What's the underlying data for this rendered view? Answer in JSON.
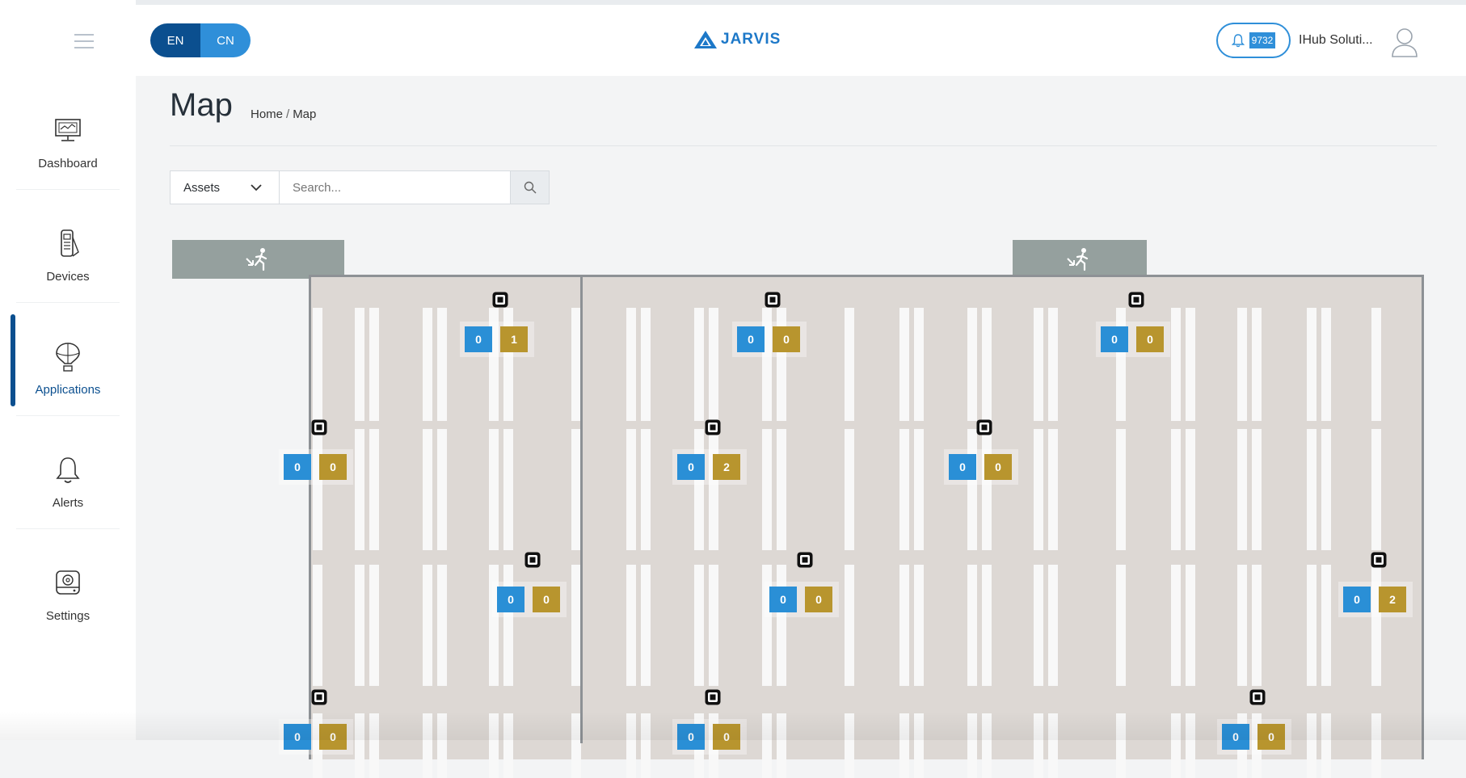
{
  "header": {
    "languages": [
      "EN",
      "CN"
    ],
    "active_language": "EN",
    "brand": "JARVIS",
    "notification_count": "9732",
    "user_name": "IHub Soluti..."
  },
  "sidebar": {
    "items": [
      {
        "label": "Dashboard",
        "icon": "monitor-icon"
      },
      {
        "label": "Devices",
        "icon": "devices-icon"
      },
      {
        "label": "Applications",
        "icon": "balloon-icon"
      },
      {
        "label": "Alerts",
        "icon": "bell-icon"
      },
      {
        "label": "Settings",
        "icon": "settings-icon"
      }
    ],
    "active": "Applications"
  },
  "page": {
    "title": "Map",
    "breadcrumb": [
      "Home",
      "Map"
    ]
  },
  "filter": {
    "category": "Assets",
    "search_placeholder": "Search..."
  },
  "map": {
    "entrances": 2,
    "sensors": [
      {
        "blue": "0",
        "gold": "1"
      },
      {
        "blue": "0",
        "gold": "0"
      },
      {
        "blue": "0",
        "gold": "0"
      },
      {
        "blue": "0",
        "gold": "0"
      },
      {
        "blue": "0",
        "gold": "2"
      },
      {
        "blue": "0",
        "gold": "0"
      },
      {
        "blue": "0",
        "gold": "0"
      },
      {
        "blue": "0",
        "gold": "0"
      },
      {
        "blue": "0",
        "gold": "2"
      },
      {
        "blue": "0",
        "gold": "0"
      },
      {
        "blue": "0",
        "gold": "0"
      },
      {
        "blue": "0",
        "gold": "0"
      }
    ]
  },
  "colors": {
    "primary_dark": "#0b4f8f",
    "primary": "#2f8fd9",
    "count_blue": "#2a8fd6",
    "count_gold": "#b8952e",
    "floor": "#ddd8d4",
    "entrance": "#95a09e"
  }
}
